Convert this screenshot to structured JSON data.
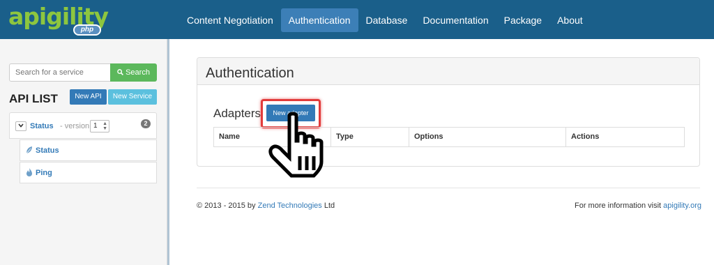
{
  "navbar": {
    "logo_text": "apigility",
    "logo_badge": "php",
    "items": [
      {
        "label": "Content Negotiation",
        "active": false
      },
      {
        "label": "Authentication",
        "active": true
      },
      {
        "label": "Database",
        "active": false
      },
      {
        "label": "Documentation",
        "active": false
      },
      {
        "label": "Package",
        "active": false
      },
      {
        "label": "About",
        "active": false
      }
    ]
  },
  "sidebar": {
    "search_placeholder": "Search for a service",
    "search_button": "Search",
    "title": "API LIST",
    "new_api_button": "New API",
    "new_service_button": "New Service",
    "api": {
      "name": "Status",
      "version_label": "- version",
      "version_value": "1",
      "service_count": "2",
      "services": [
        {
          "label": "Status",
          "icon": "leaf-icon"
        },
        {
          "label": "Ping",
          "icon": "fire-icon"
        }
      ]
    }
  },
  "main": {
    "panel_title": "Authentication",
    "adapters_title": "Adapters",
    "new_adapter_button": "New adapter",
    "table_headers": [
      "Name",
      "Type",
      "Options",
      "Actions"
    ]
  },
  "footer": {
    "copyright": "© 2013 - 2015 by",
    "company": "Zend Technologies",
    "suffix": "Ltd",
    "info_text": "For more information visit",
    "info_link": "apigility.org"
  },
  "colors": {
    "navbar": "#1a5f8a",
    "nav_active": "#3c7fb7",
    "logo_green": "#8dc63f",
    "primary": "#337ab7",
    "success": "#5cb85c",
    "info": "#5bc0de",
    "highlight": "#e23b3b"
  }
}
